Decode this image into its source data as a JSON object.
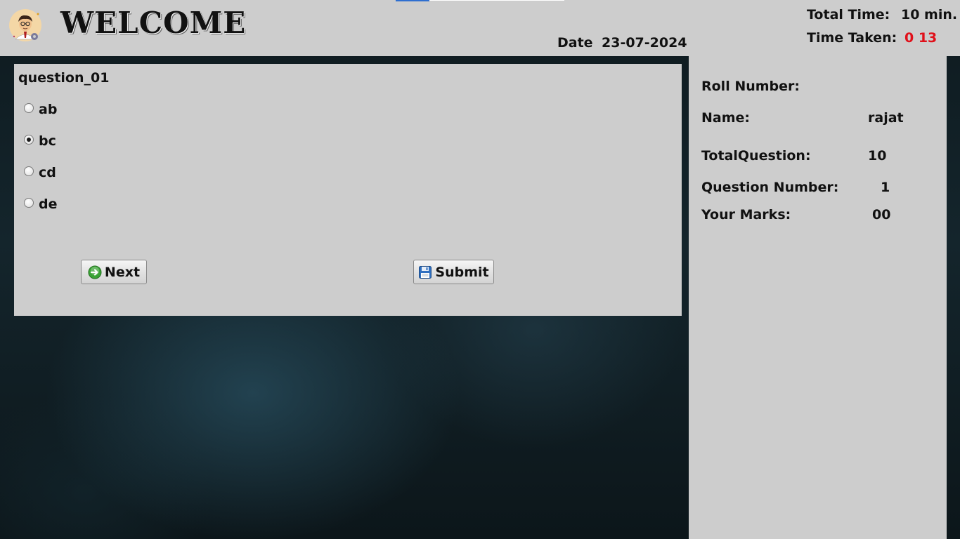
{
  "header": {
    "title": "WELCOME",
    "date_label": "Date",
    "date_value": "23-07-2024",
    "total_time_label": "Total Time:",
    "total_time_value": "10 min.",
    "time_taken_label": "Time Taken:",
    "time_taken_value": "0 13"
  },
  "question": {
    "title": "question_01",
    "options": [
      {
        "label": "ab",
        "selected": false
      },
      {
        "label": "bc",
        "selected": true
      },
      {
        "label": "cd",
        "selected": false
      },
      {
        "label": "de",
        "selected": false
      }
    ],
    "next_label": "Next",
    "submit_label": "Submit"
  },
  "info": {
    "roll_label": "Roll Number:",
    "roll_value": "",
    "name_label": "Name:",
    "name_value": "rajat",
    "total_q_label": "TotalQuestion:",
    "total_q_value": "10",
    "q_number_label": "Question Number:",
    "q_number_value": "1",
    "marks_label": "Your Marks:",
    "marks_value": "00"
  },
  "colors": {
    "panel": "#cdcdcd",
    "time_taken": "#e0101a",
    "accent": "#2f6fd0"
  },
  "icons": [
    "avatar-icon",
    "next-arrow-icon",
    "save-disk-icon"
  ]
}
